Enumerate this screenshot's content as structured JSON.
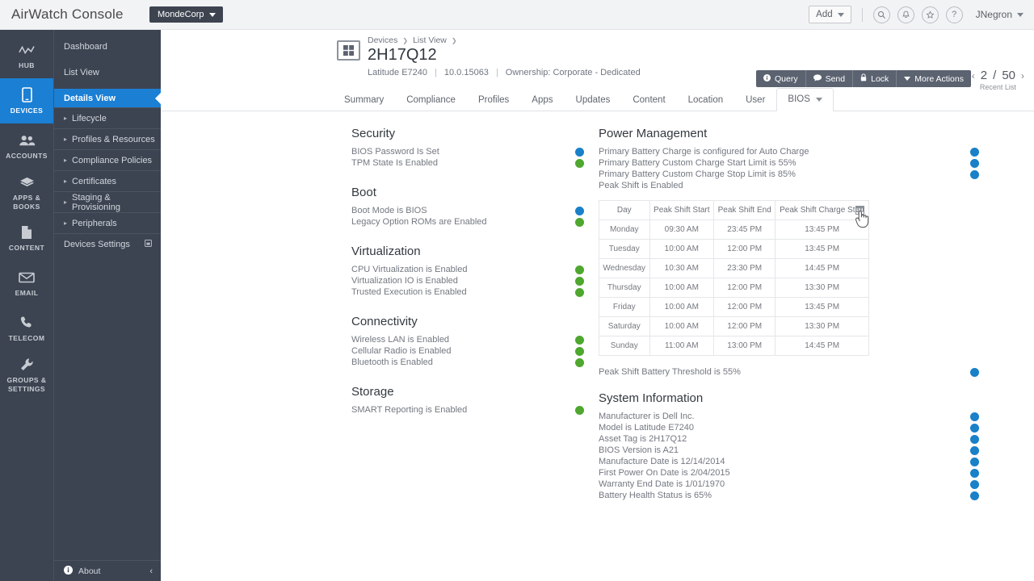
{
  "topbar": {
    "brand": "AirWatch Console",
    "org_chip": "MondeCorp",
    "add_label": "Add",
    "user": "JNegron",
    "icons": [
      "search-icon",
      "bell-icon",
      "star-icon",
      "help-icon"
    ]
  },
  "rail": {
    "items": [
      {
        "label": "HUB",
        "icon": "activity-icon",
        "active": false
      },
      {
        "label": "DEVICES",
        "icon": "device-icon",
        "active": true
      },
      {
        "label": "ACCOUNTS",
        "icon": "users-icon",
        "active": false
      },
      {
        "label": "APPS &\nBOOKS",
        "icon": "cube-icon",
        "active": false
      },
      {
        "label": "CONTENT",
        "icon": "document-icon",
        "active": false
      },
      {
        "label": "EMAIL",
        "icon": "envelope-icon",
        "active": false
      },
      {
        "label": "TELECOM",
        "icon": "phone-icon",
        "active": false
      },
      {
        "label": "GROUPS &\nSETTINGS",
        "icon": "wrench-icon",
        "active": false
      }
    ]
  },
  "subnav": {
    "items": [
      {
        "label": "Dashboard",
        "expandable": false,
        "active": false
      },
      {
        "label": "List View",
        "expandable": false,
        "active": false
      },
      {
        "label": "Details View",
        "expandable": false,
        "active": true
      },
      {
        "label": "Lifecycle",
        "expandable": true,
        "active": false
      },
      {
        "label": "Profiles & Resources",
        "expandable": true,
        "active": false
      },
      {
        "label": "Compliance Policies",
        "expandable": true,
        "active": false
      },
      {
        "label": "Certificates",
        "expandable": true,
        "active": false
      },
      {
        "label": "Staging & Provisioning",
        "expandable": true,
        "active": false
      },
      {
        "label": "Peripherals",
        "expandable": true,
        "active": false
      },
      {
        "label": "Devices Settings",
        "expandable": false,
        "active": false
      }
    ],
    "about_label": "About"
  },
  "breadcrumb": {
    "items": [
      "Devices",
      "List View"
    ]
  },
  "device": {
    "name": "2H17Q12",
    "model": "Latitude E7240",
    "os_version": "10.0.15063",
    "ownership": "Ownership: Corporate - Dedicated",
    "platform_icon": "windows-icon"
  },
  "actions": {
    "buttons": [
      {
        "label": "Query",
        "icon": "info-icon"
      },
      {
        "label": "Send",
        "icon": "message-icon"
      },
      {
        "label": "Lock",
        "icon": "lock-icon"
      },
      {
        "label": "More Actions",
        "icon": "caret-down-icon"
      }
    ]
  },
  "pager": {
    "prev": "‹",
    "current": "2",
    "divider": "/",
    "total": "50",
    "next": "›",
    "sub_label": "Recent List"
  },
  "tabs": {
    "items": [
      "Summary",
      "Compliance",
      "Profiles",
      "Apps",
      "Updates",
      "Content",
      "Location",
      "User"
    ],
    "active": "BIOS"
  },
  "left_sections": [
    {
      "title": "Security",
      "rows": [
        {
          "text": "BIOS Password Is Set",
          "status": "info"
        },
        {
          "text": "TPM State Is Enabled",
          "status": "ok"
        }
      ]
    },
    {
      "title": "Boot",
      "rows": [
        {
          "text": "Boot Mode is BIOS",
          "status": "info"
        },
        {
          "text": "Legacy Option ROMs are Enabled",
          "status": "ok"
        }
      ]
    },
    {
      "title": "Virtualization",
      "rows": [
        {
          "text": "CPU Virtualization is Enabled",
          "status": "ok"
        },
        {
          "text": "Virtualization IO is Enabled",
          "status": "ok"
        },
        {
          "text": "Trusted Execution is Enabled",
          "status": "ok"
        }
      ]
    },
    {
      "title": "Connectivity",
      "rows": [
        {
          "text": "Wireless LAN is Enabled",
          "status": "ok"
        },
        {
          "text": "Cellular Radio is Enabled",
          "status": "ok"
        },
        {
          "text": "Bluetooth is Enabled",
          "status": "ok"
        }
      ]
    },
    {
      "title": "Storage",
      "rows": [
        {
          "text": "SMART Reporting is Enabled",
          "status": "ok"
        }
      ]
    }
  ],
  "power": {
    "title": "Power Management",
    "rows": [
      {
        "text": "Primary Battery Charge is configured for Auto Charge",
        "status": "info"
      },
      {
        "text": "Primary Battery Custom Charge Start Limit is 55%",
        "status": "info"
      },
      {
        "text": "Primary Battery Custom Charge Stop Limit is 85%",
        "status": "info"
      },
      {
        "text": "Peak Shift is Enabled",
        "status": "none",
        "icon": "calendar-icon"
      }
    ],
    "threshold_row": {
      "text": "Peak Shift Battery Threshold is 55%",
      "status": "info"
    }
  },
  "peak_shift_table": {
    "columns": [
      "Day",
      "Peak Shift Start",
      "Peak Shift End",
      "Peak Shift Charge Start"
    ],
    "rows": [
      [
        "Monday",
        "09:30 AM",
        "23:45 PM",
        "13:45 PM"
      ],
      [
        "Tuesday",
        "10:00 AM",
        "12:00 PM",
        "13:45 PM"
      ],
      [
        "Wednesday",
        "10:30 AM",
        "23:30 PM",
        "14:45 PM"
      ],
      [
        "Thursday",
        "10:00 AM",
        "12:00 PM",
        "13:30 PM"
      ],
      [
        "Friday",
        "10:00 AM",
        "12:00 PM",
        "13:45 PM"
      ],
      [
        "Saturday",
        "10:00 AM",
        "12:00 PM",
        "13:30 PM"
      ],
      [
        "Sunday",
        "11:00 AM",
        "13:00 PM",
        "14:45 PM"
      ]
    ]
  },
  "system_info": {
    "title": "System Information",
    "rows": [
      {
        "text": "Manufacturer is Dell Inc.",
        "status": "info"
      },
      {
        "text": "Model is Latitude E7240",
        "status": "info"
      },
      {
        "text": "Asset Tag is 2H17Q12",
        "status": "info"
      },
      {
        "text": "BIOS Version is A21",
        "status": "info"
      },
      {
        "text": "Manufacture Date is 12/14/2014",
        "status": "info"
      },
      {
        "text": "First Power On Date is 2/04/2015",
        "status": "info"
      },
      {
        "text": "Warranty End Date is 1/01/1970",
        "status": "info"
      },
      {
        "text": "Battery Health Status is 65%",
        "status": "info"
      }
    ]
  },
  "colors": {
    "accent_blue": "#1b7fd4",
    "nav_dark": "#3c4452",
    "info": "#1a80c8",
    "ok": "#4ea72e",
    "action_btn": "#5b6270"
  }
}
